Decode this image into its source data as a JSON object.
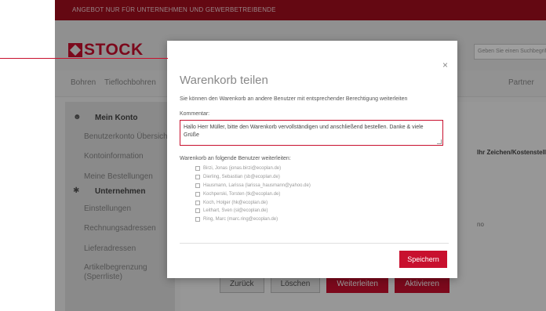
{
  "topbar": {
    "text": "ANGEBOT NUR FÜR UNTERNEHMEN UND GEWERBETREIBENDE"
  },
  "header": {
    "logo_text": "STOCK",
    "search_placeholder": "Geben Sie einen Suchbegriff ein"
  },
  "nav": {
    "items": [
      "Bohren",
      "Tieflochbohren",
      "Partner"
    ]
  },
  "sidebar": {
    "konto_title": "Mein Konto",
    "konto_items": [
      "Benutzerkonto Übersicht",
      "Kontoinformation",
      "Meine Bestellungen"
    ],
    "unternehmen_title": "Unternehmen",
    "unternehmen_items": [
      "Einstellungen",
      "Rechnungsadressen",
      "Lieferadressen",
      "Artikelbegrenzung",
      "(Sperrliste)"
    ]
  },
  "content": {
    "column_header": "Ihr Zeichen/Kostenstelle",
    "text_fragment": "no"
  },
  "actions": {
    "back": "Zurück",
    "delete": "Löschen",
    "forward": "Weiterleiten",
    "activate": "Aktivieren"
  },
  "modal": {
    "close": "×",
    "title": "Warenkorb teilen",
    "description": "Sie können den Warenkorb an andere Benutzer mit entsprechender Berechtigung weiterleiten",
    "comment_label": "Kommentar:",
    "comment_value": "Hallo Herr Müller, bitte den Warenkorb vervollständigen und anschließend bestellen. Danke & viele Grüße",
    "forward_label": "Warenkorb an folgende Benutzer weiterleiten:",
    "users": [
      "Birzi, Jonas (jonas.birzi@ecoplan.de)",
      "Dierling, Sebastian (sb@ecoplan.de)",
      "Hausmann, Larissa (larissa_hausmann@yahoo.de)",
      "Kochperski, Torsten (tk@ecoplan.de)",
      "Koch, Holger (hk@ecoplan.de)",
      "Leithart, Sven (sl@ecoplan.de)",
      "Ring, Marc (marc.ring@ecoplan.de)"
    ],
    "save": "Speichern"
  },
  "colors": {
    "brand_red": "#c8102e",
    "topbar_red": "#a20d1e"
  }
}
